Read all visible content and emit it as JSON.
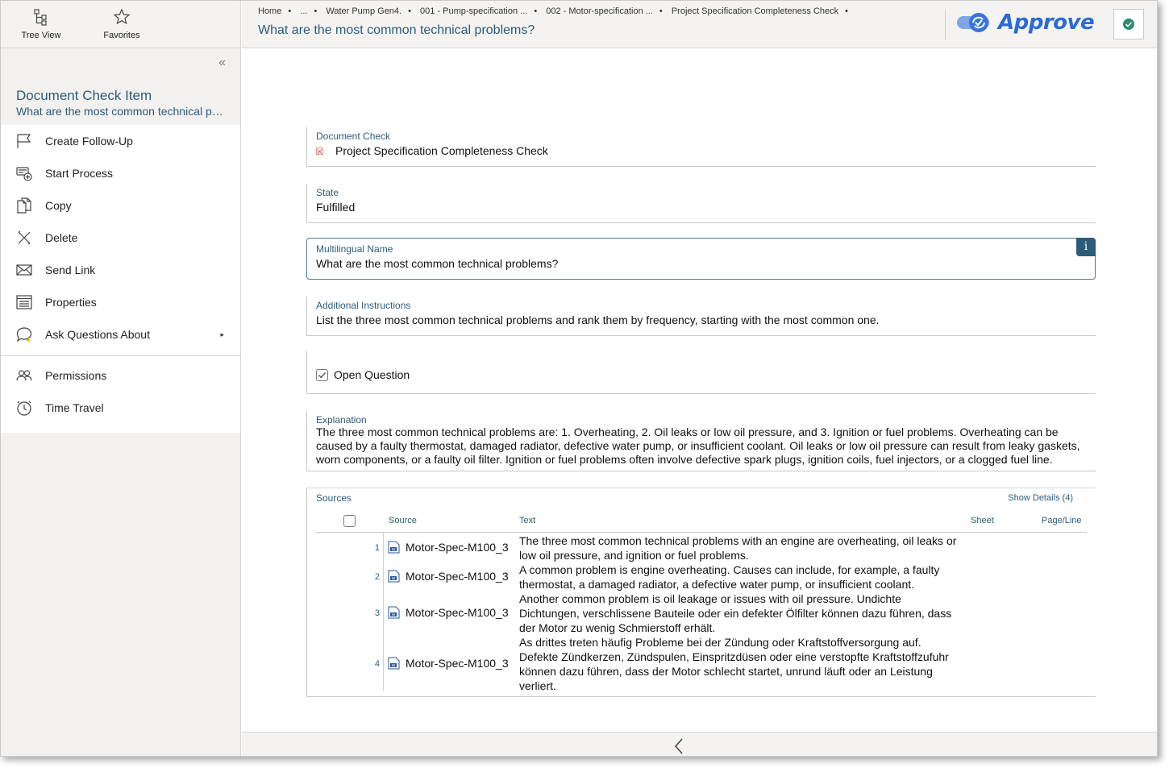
{
  "sidebar": {
    "tools": [
      {
        "label": "Tree View",
        "icon": "tree-view-icon"
      },
      {
        "label": "Favorites",
        "icon": "star-icon"
      }
    ],
    "collapse_glyph": "«",
    "header": {
      "title": "Document Check Item",
      "subtitle": "What are the most common technical problems?"
    },
    "menu": [
      {
        "label": "Create Follow-Up",
        "icon": "flag-icon"
      },
      {
        "label": "Start Process",
        "icon": "start-process-icon"
      },
      {
        "label": "Copy",
        "icon": "copy-icon"
      },
      {
        "label": "Delete",
        "icon": "delete-icon"
      },
      {
        "label": "Send Link",
        "icon": "envelope-icon"
      },
      {
        "label": "Properties",
        "icon": "properties-icon"
      },
      {
        "label": "Ask Questions About",
        "icon": "chat-ai-icon",
        "submenu_arrow": "▸"
      }
    ],
    "menu2": [
      {
        "label": "Permissions",
        "icon": "permissions-icon"
      },
      {
        "label": "Time Travel",
        "icon": "clock-icon"
      }
    ]
  },
  "header": {
    "breadcrumbs": [
      "Home",
      "...",
      "Water Pump Gen4.",
      "001 - Pump-specification ...",
      "002 - Motor-specification ...",
      "Project Specification Completeness Check"
    ],
    "breadcrumb_separator": "•",
    "title": "What are the most common technical problems?",
    "logo_text": "Approve",
    "colors": {
      "accent": "#2d5b7a",
      "logo": "#2a6ad9",
      "status_ok": "#2e8b6e"
    }
  },
  "fields": {
    "document_check": {
      "label": "Document Check",
      "value": "Project Specification Completeness Check"
    },
    "state": {
      "label": "State",
      "value": "Fulfilled"
    },
    "multilingual_name": {
      "label": "Multilingual Name",
      "value": "What are the most common technical problems?",
      "info_glyph": "i"
    },
    "additional_instructions": {
      "label": "Additional Instructions",
      "value": "List the three most common technical problems and rank them by frequency, starting with the most common one."
    },
    "open_question": {
      "label": "Open Question",
      "checked": true
    },
    "explanation": {
      "label": "Explanation",
      "value": "The three most common technical problems are: 1. Overheating, 2. Oil leaks or low oil pressure, and 3. Ignition or fuel problems. Overheating can be caused by a faulty thermostat, damaged radiator, defective water pump, or insufficient coolant. Oil leaks or low oil pressure can result from leaky gaskets, worn components, or a faulty oil filter. Ignition or fuel problems often involve defective spark plugs, ignition coils, fuel injectors, or a clogged fuel line."
    }
  },
  "sources": {
    "label": "Sources",
    "show_details": "Show Details (4)",
    "columns": [
      "Source",
      "Text",
      "Sheet",
      "Page/Line"
    ],
    "rows": [
      {
        "num": "1",
        "source": "Motor-Spec-M100_3",
        "text": "The three most common technical problems with an engine are overheating, oil leaks or low oil pressure, and ignition or fuel problems."
      },
      {
        "num": "2",
        "source": "Motor-Spec-M100_3",
        "text": "A common problem is engine overheating. Causes can include, for example, a faulty thermostat, a damaged radiator, a defective water pump, or insufficient coolant."
      },
      {
        "num": "3",
        "source": "Motor-Spec-M100_3",
        "text": "Another common problem is oil leakage or issues with oil pressure. Undichte Dichtungen, verschlissene Bauteile oder ein defekter Ölfilter können dazu führen, dass der Motor zu wenig Schmierstoff erhält."
      },
      {
        "num": "4",
        "source": "Motor-Spec-M100_3",
        "text": "As drittes treten häufig Probleme bei der Zündung oder Kraftstoffversorgung auf. Defekte Zündkerzen, Zündspulen, Einspritzdüsen oder eine verstopfte Kraftstoffzufuhr können dazu führen, dass der Motor schlecht startet, unrund läuft oder an Leistung verliert."
      }
    ]
  }
}
